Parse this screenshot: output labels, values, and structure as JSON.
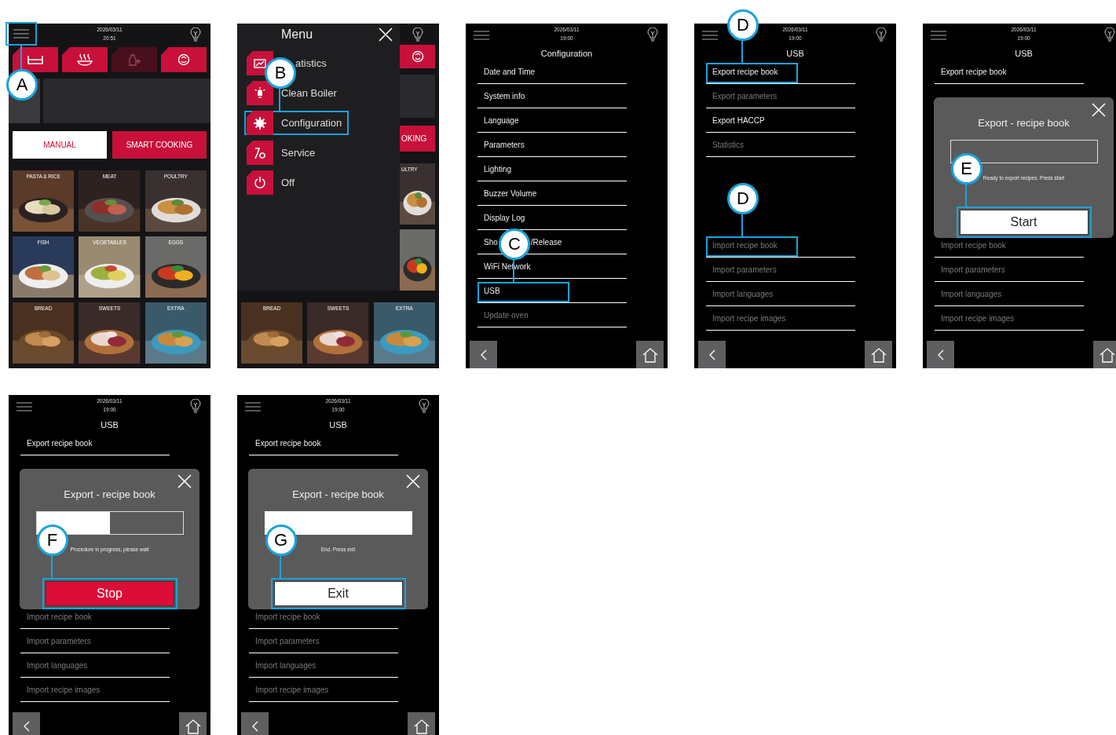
{
  "screens": [
    {
      "kind": "home",
      "date": "2026/03/11",
      "time": "20:51",
      "menu_button": {
        "highlighted": true,
        "callout": "A"
      },
      "top_tabs": [
        {
          "disabled": false
        },
        {
          "disabled": false
        },
        {
          "disabled": true
        },
        {
          "disabled": false
        }
      ],
      "modes": [
        {
          "label": "MANUAL",
          "selected": true
        },
        {
          "label": "SMART COOKING",
          "selected": false
        }
      ],
      "tiles": [
        {
          "label": "PASTA & RICE"
        },
        {
          "label": "MEAT"
        },
        {
          "label": "POULTRY"
        },
        {
          "label": "FISH"
        },
        {
          "label": "VEGETABLES"
        },
        {
          "label": "EGGS"
        },
        {
          "label": "BREAD"
        },
        {
          "label": "SWEETS"
        },
        {
          "label": "EXTRA"
        }
      ]
    },
    {
      "kind": "menu",
      "title": "Menu",
      "items": [
        {
          "label": "atistics",
          "highlighted": false
        },
        {
          "label": "Clean Boiler",
          "highlighted": false
        },
        {
          "label": "Configuration",
          "highlighted": true,
          "callout": "B"
        },
        {
          "label": "Service",
          "highlighted": false
        },
        {
          "label": "Off",
          "highlighted": false
        }
      ],
      "behind": {
        "mode_label": "OKING",
        "tile_label": "ULTRY",
        "tiles": [
          {
            "label": "BREAD"
          },
          {
            "label": "SWEETS"
          },
          {
            "label": "EXTRA"
          }
        ]
      }
    },
    {
      "kind": "list",
      "date": "2026/03/11",
      "time": "19:00",
      "title": "Configuration",
      "sections": [
        {
          "items": [
            {
              "label": "Date and Time",
              "disabled": false,
              "highlighted": false
            },
            {
              "label": "System info",
              "disabled": false,
              "highlighted": false
            },
            {
              "label": "Language",
              "disabled": false,
              "highlighted": false
            },
            {
              "label": "Parameters",
              "disabled": false,
              "highlighted": false
            },
            {
              "label": "Lighting",
              "disabled": false,
              "highlighted": false
            },
            {
              "label": "Buzzer Volume",
              "disabled": false,
              "highlighted": false
            },
            {
              "label": "Display Log",
              "disabled": false,
              "highlighted": false
            },
            {
              "label": "Sho",
              "label_tail": "/Release",
              "disabled": false,
              "highlighted": false
            },
            {
              "label": "WiFi Network",
              "disabled": false,
              "highlighted": false
            },
            {
              "label": "USB",
              "disabled": false,
              "highlighted": true,
              "callout": "C"
            },
            {
              "label": "Update oven",
              "disabled": true,
              "highlighted": false
            }
          ]
        }
      ]
    },
    {
      "kind": "list",
      "date": "2026/03/11",
      "time": "19:00",
      "title": "USB",
      "sections": [
        {
          "items": [
            {
              "label": "Export recipe book",
              "disabled": false,
              "highlighted": true,
              "callout": "D"
            },
            {
              "label": "Export parameters",
              "disabled": true,
              "highlighted": false
            },
            {
              "label": "Export HACCP",
              "disabled": false,
              "highlighted": false
            },
            {
              "label": "Statistics",
              "disabled": true,
              "highlighted": false
            }
          ]
        },
        {
          "items": [
            {
              "label": "Import recipe book",
              "disabled": true,
              "highlighted": true,
              "callout": "D"
            },
            {
              "label": "Import parameters",
              "disabled": true,
              "highlighted": false
            },
            {
              "label": "Import languages",
              "disabled": true,
              "highlighted": false
            },
            {
              "label": "Import recipe images",
              "disabled": true,
              "highlighted": false
            }
          ]
        }
      ]
    },
    {
      "kind": "dialog",
      "date": "2026/03/11",
      "time": "19:00",
      "title": "USB",
      "sections": [
        {
          "items": [
            {
              "label": "Export recipe book",
              "disabled": false,
              "highlighted": false
            }
          ]
        },
        {
          "items": [
            {
              "label": "Import recipe book",
              "disabled": true,
              "highlighted": false
            },
            {
              "label": "Import parameters",
              "disabled": true,
              "highlighted": false
            },
            {
              "label": "Import languages",
              "disabled": true,
              "highlighted": false
            },
            {
              "label": "Import recipe images",
              "disabled": true,
              "highlighted": false
            }
          ]
        }
      ],
      "dialog": {
        "title": "Export - recipe book",
        "level": 0,
        "status": "Ready to export recipes. Press start",
        "button": {
          "kind": "start",
          "label": "Start",
          "highlighted": true,
          "callout": "E"
        }
      }
    },
    {
      "kind": "dialog",
      "date": "2026/03/11",
      "time": "19:00",
      "title": "USB",
      "sections": [
        {
          "items": [
            {
              "label": "Export recipe book",
              "disabled": false,
              "highlighted": false
            }
          ]
        },
        {
          "items": [
            {
              "label": "Import recipe book",
              "disabled": true,
              "highlighted": false
            },
            {
              "label": "Import parameters",
              "disabled": true,
              "highlighted": false
            },
            {
              "label": "Import languages",
              "disabled": true,
              "highlighted": false
            },
            {
              "label": "Import recipe images",
              "disabled": true,
              "highlighted": false
            }
          ]
        }
      ],
      "dialog": {
        "title": "Export - recipe book",
        "level": 0.5,
        "status": "Procedure in progress, please wait",
        "button": {
          "kind": "stop",
          "label": "Stop",
          "highlighted": true,
          "callout": "F"
        }
      }
    },
    {
      "kind": "dialog",
      "date": "2026/03/11",
      "time": "19:00",
      "title": "USB",
      "sections": [
        {
          "items": [
            {
              "label": "Export recipe book",
              "disabled": false,
              "highlighted": false
            }
          ]
        },
        {
          "items": [
            {
              "label": "Import recipe book",
              "disabled": true,
              "highlighted": false
            },
            {
              "label": "Import parameters",
              "disabled": true,
              "highlighted": false
            },
            {
              "label": "Import languages",
              "disabled": true,
              "highlighted": false
            },
            {
              "label": "Import recipe images",
              "disabled": true,
              "highlighted": false
            }
          ]
        }
      ],
      "dialog": {
        "title": "Export - recipe book",
        "level": 1,
        "status": "End. Press exit",
        "button": {
          "kind": "exit",
          "label": "Exit",
          "highlighted": true,
          "callout": "G"
        }
      }
    }
  ]
}
